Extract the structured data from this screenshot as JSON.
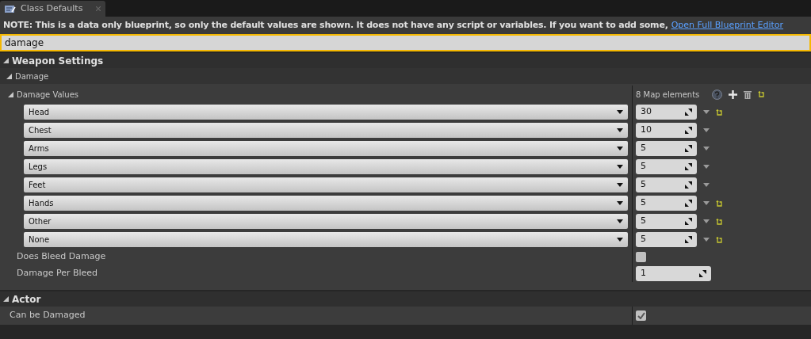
{
  "tab": {
    "title": "Class Defaults",
    "selected": true
  },
  "note": {
    "text": "NOTE: This is a data only blueprint, so only the default values are shown.  It does not have any script or variables.  If you want to add some,",
    "link": "Open Full Blueprint Editor"
  },
  "search": {
    "value": "damage"
  },
  "categories": [
    {
      "title": "Weapon Settings",
      "expanded": true,
      "subcategories": [
        {
          "title": "Damage",
          "expanded": true,
          "map": {
            "label": "Damage Values",
            "expanded": true,
            "count": "8 Map elements",
            "modified": true,
            "entries": [
              {
                "key": "Head",
                "value": "30",
                "modified": true
              },
              {
                "key": "Chest",
                "value": "10",
                "modified": false
              },
              {
                "key": "Arms",
                "value": "5",
                "modified": false
              },
              {
                "key": "Legs",
                "value": "5",
                "modified": false
              },
              {
                "key": "Feet",
                "value": "5",
                "modified": false
              },
              {
                "key": "Hands",
                "value": "5",
                "modified": true
              },
              {
                "key": "Other",
                "value": "5",
                "modified": true
              },
              {
                "key": "None",
                "value": "5",
                "modified": true
              }
            ]
          },
          "properties": [
            {
              "kind": "checkbox",
              "label": "Does Bleed Damage",
              "checked": false
            },
            {
              "kind": "number",
              "label": "Damage Per Bleed",
              "value": "1"
            }
          ]
        }
      ]
    },
    {
      "title": "Actor",
      "expanded": true,
      "properties": [
        {
          "kind": "checkbox",
          "label": "Can be Damaged",
          "checked": true
        }
      ]
    }
  ]
}
